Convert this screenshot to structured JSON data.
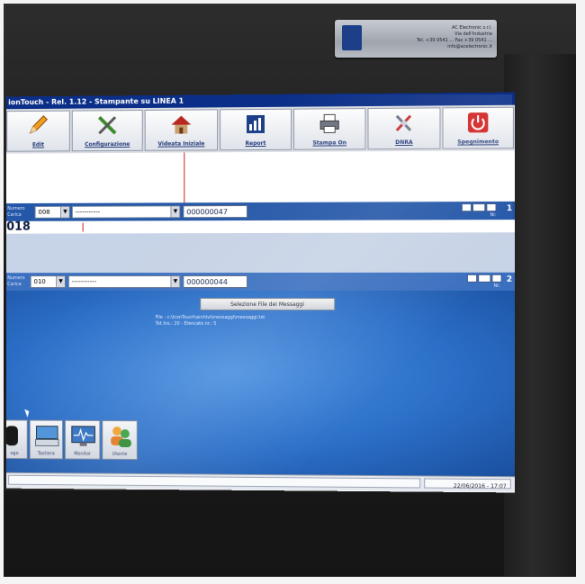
{
  "plate": {
    "lines": [
      "AC Electronic s.r.l.",
      "Via dell'Industria",
      "Tel. +39 0541 ... Fax +39 0541 ...",
      "info@acelectronic.it"
    ]
  },
  "app": {
    "title": "ionTouch - Rel. 1.12   -   Stampante su LINEA 1"
  },
  "toolbar": {
    "buttons": [
      {
        "label": "Edit",
        "icon": "pencil-icon"
      },
      {
        "label": "Configurazione",
        "icon": "tools-icon"
      },
      {
        "label": "Videata Iniziale",
        "icon": "home-icon"
      },
      {
        "label": "Report",
        "icon": "report-icon"
      },
      {
        "label": "Stampa On",
        "icon": "printer-icon"
      },
      {
        "label": "DNRA",
        "icon": "settings-icon"
      },
      {
        "label": "Spegnimento",
        "icon": "power-icon"
      }
    ]
  },
  "line1": {
    "label_top": "Numero",
    "label_bottom": "Carica",
    "code": "008",
    "message": "-----------",
    "counter": "000000047",
    "big_text": "018",
    "line_number": "1",
    "nav_label": "Nr."
  },
  "line2": {
    "label_top": "Numero",
    "label_bottom": "Carica",
    "code": "010",
    "message": "-----------",
    "counter": "000000044",
    "line_number": "2",
    "nav_label": "Nr.",
    "message_button": "Selezione File dei Messaggi",
    "info_line1": "File : c:\\IconTouch\\archivi\\messaggi\\messaggi.txt",
    "info_line2": "Tot.Ins.: 20 - Elencato nr.: 5"
  },
  "dock": {
    "items": [
      {
        "label": "ogo",
        "icon": "logo-icon"
      },
      {
        "label": "Tastiera",
        "icon": "keyboard-icon"
      },
      {
        "label": "Monitor",
        "icon": "monitor-icon"
      },
      {
        "label": "Utente",
        "icon": "users-icon"
      }
    ]
  },
  "status": {
    "datetime": "22/06/2016 - 17:07"
  }
}
